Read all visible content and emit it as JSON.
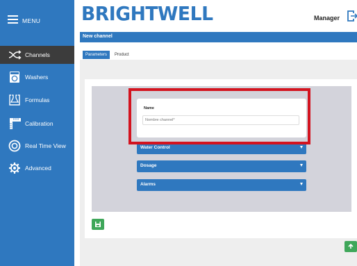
{
  "sidebar": {
    "menu_label": "MENU",
    "items": [
      {
        "label": "Channels",
        "icon": "shuffle-icon",
        "active": true
      },
      {
        "label": "Washers",
        "icon": "washer-icon",
        "active": false
      },
      {
        "label": "Formulas",
        "icon": "formula-icon",
        "active": false
      },
      {
        "label": "Calibration",
        "icon": "ruler-icon",
        "active": false
      },
      {
        "label": "Real Time View",
        "icon": "eye-icon",
        "active": false
      },
      {
        "label": "Advanced",
        "icon": "gear-icon",
        "active": false
      }
    ]
  },
  "header": {
    "brand": "BRIGHTWELL",
    "user": "Manager"
  },
  "page": {
    "title": "New channel",
    "tabs": [
      {
        "label": "Parameters",
        "active": true
      },
      {
        "label": "Product",
        "active": false
      }
    ]
  },
  "form": {
    "name_label": "Name",
    "name_placeholder": "Nombre channel*",
    "sections": [
      "Water Control",
      "Dosage",
      "Alarms"
    ]
  },
  "colors": {
    "primary": "#2f78bf",
    "active_item": "#3c3c3c",
    "save_green": "#3fa75a",
    "highlight": "#d3131f"
  }
}
